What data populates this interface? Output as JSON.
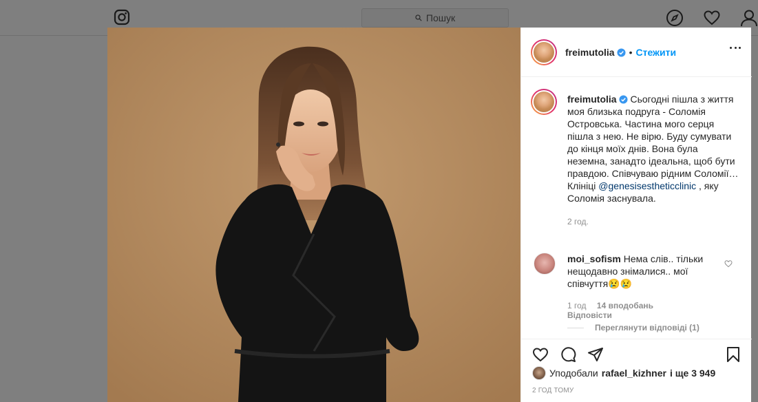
{
  "topbar": {
    "logo": "instagram-icon",
    "search_placeholder": "Пошук",
    "nav_icons": [
      "compass-icon",
      "heart-icon",
      "profile-icon"
    ]
  },
  "post": {
    "author": "freimutolia",
    "follow_label": "Стежити",
    "caption_author": "freimutolia",
    "caption_before_mention": "Сьогодні пішла з життя моя близька подруга - Соломія Островська. Частина мого серця пішла з нею. Не вірю. Буду сумувати до кінця моїх днів. Вона була неземна, занадто ідеальна, щоб бути правдою. Співчуваю рідним Соломії… Клініці",
    "caption_mention": "@genesisestheticclinic",
    "caption_after_mention": ", яку Соломія заснувала.",
    "caption_time": "2 год.",
    "comment": {
      "author": "moi_sofism",
      "text": "Нема слів.. тільки нещодавно знімалися.. мої співчуття😢😢",
      "time": "1 год",
      "likes": "14 вподобань",
      "reply": "Відповісти",
      "view_replies": "Переглянути відповіді (1)"
    },
    "liked_by_prefix": "Уподобали",
    "liked_by_user": "rafael_kizhner",
    "liked_by_suffix": "і ще 3 949",
    "post_time": "2 ГОД ТОМУ"
  },
  "colors": {
    "accent": "#0095f6",
    "background_dim": "#7f7f7f",
    "photo_bg": "#b0865c"
  }
}
